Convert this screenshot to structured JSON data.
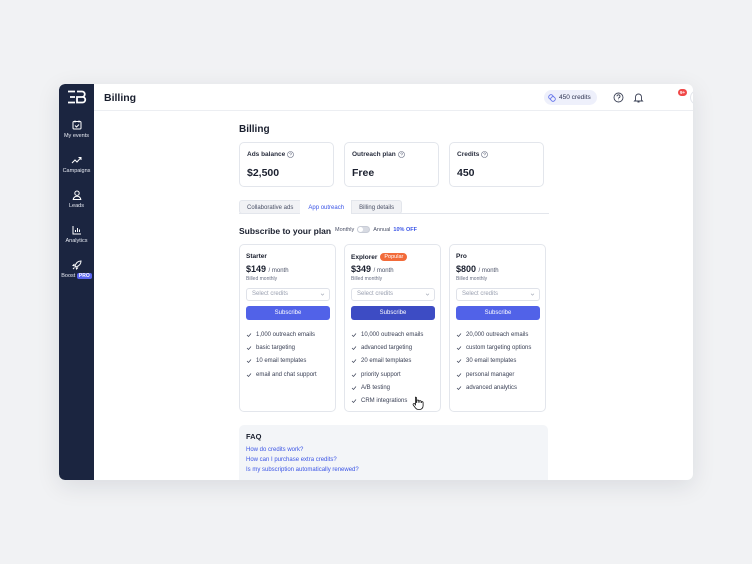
{
  "topbar": {
    "title": "Billing",
    "credits": "450 credits",
    "notification_count": "9+"
  },
  "sidebar": {
    "items": [
      {
        "label": "My events",
        "icon": "calendar-check-icon"
      },
      {
        "label": "Campaigns",
        "icon": "trend-line-icon"
      },
      {
        "label": "Leads",
        "icon": "user-icon"
      },
      {
        "label": "Analytics",
        "icon": "bar-chart-icon"
      },
      {
        "label": "Boost",
        "icon": "rocket-icon",
        "badge": "PRO"
      }
    ]
  },
  "page": {
    "title": "Billing"
  },
  "stats": [
    {
      "label": "Ads balance",
      "value": "$2,500"
    },
    {
      "label": "Outreach plan",
      "value": "Free"
    },
    {
      "label": "Credits",
      "value": "450"
    }
  ],
  "tabs": [
    {
      "label": "Collaborative ads",
      "active": false
    },
    {
      "label": "App outreach",
      "active": true
    },
    {
      "label": "Billing details",
      "active": false
    }
  ],
  "subscribe": {
    "title": "Subscribe to your plan",
    "toggle_left": "Monthly",
    "toggle_right": "Annual",
    "discount": "10% OFF"
  },
  "plans": [
    {
      "name": "Starter",
      "price": "$149",
      "period": "/ month",
      "billed": "Billed monthly",
      "select_placeholder": "Select credits",
      "button": "Subscribe",
      "features": [
        "1,000 outreach emails",
        "basic targeting",
        "10 email templates",
        "email and chat support"
      ]
    },
    {
      "name": "Explorer",
      "badge": "Popular",
      "price": "$349",
      "period": "/ month",
      "billed": "Billed monthly",
      "select_placeholder": "Select credits",
      "button": "Subscribe",
      "features": [
        "10,000 outreach emails",
        "advanced targeting",
        "20 email templates",
        "priority support",
        "A/B testing",
        "CRM integrations"
      ]
    },
    {
      "name": "Pro",
      "price": "$800",
      "period": "/ month",
      "billed": "Billed monthly",
      "select_placeholder": "Select credits",
      "button": "Subscribe",
      "features": [
        "20,000 outreach emails",
        "custom targeting options",
        "30 email templates",
        "personal manager",
        "advanced analytics"
      ]
    }
  ],
  "faq": {
    "title": "FAQ",
    "links": [
      "How do credits work?",
      "How can I purchase extra credits?",
      "Is my subscription automatically renewed?"
    ]
  },
  "colors": {
    "sidebar": "#1b2540",
    "accent": "#5162e8",
    "popular": "#f26b3a",
    "notification": "#f04848"
  }
}
